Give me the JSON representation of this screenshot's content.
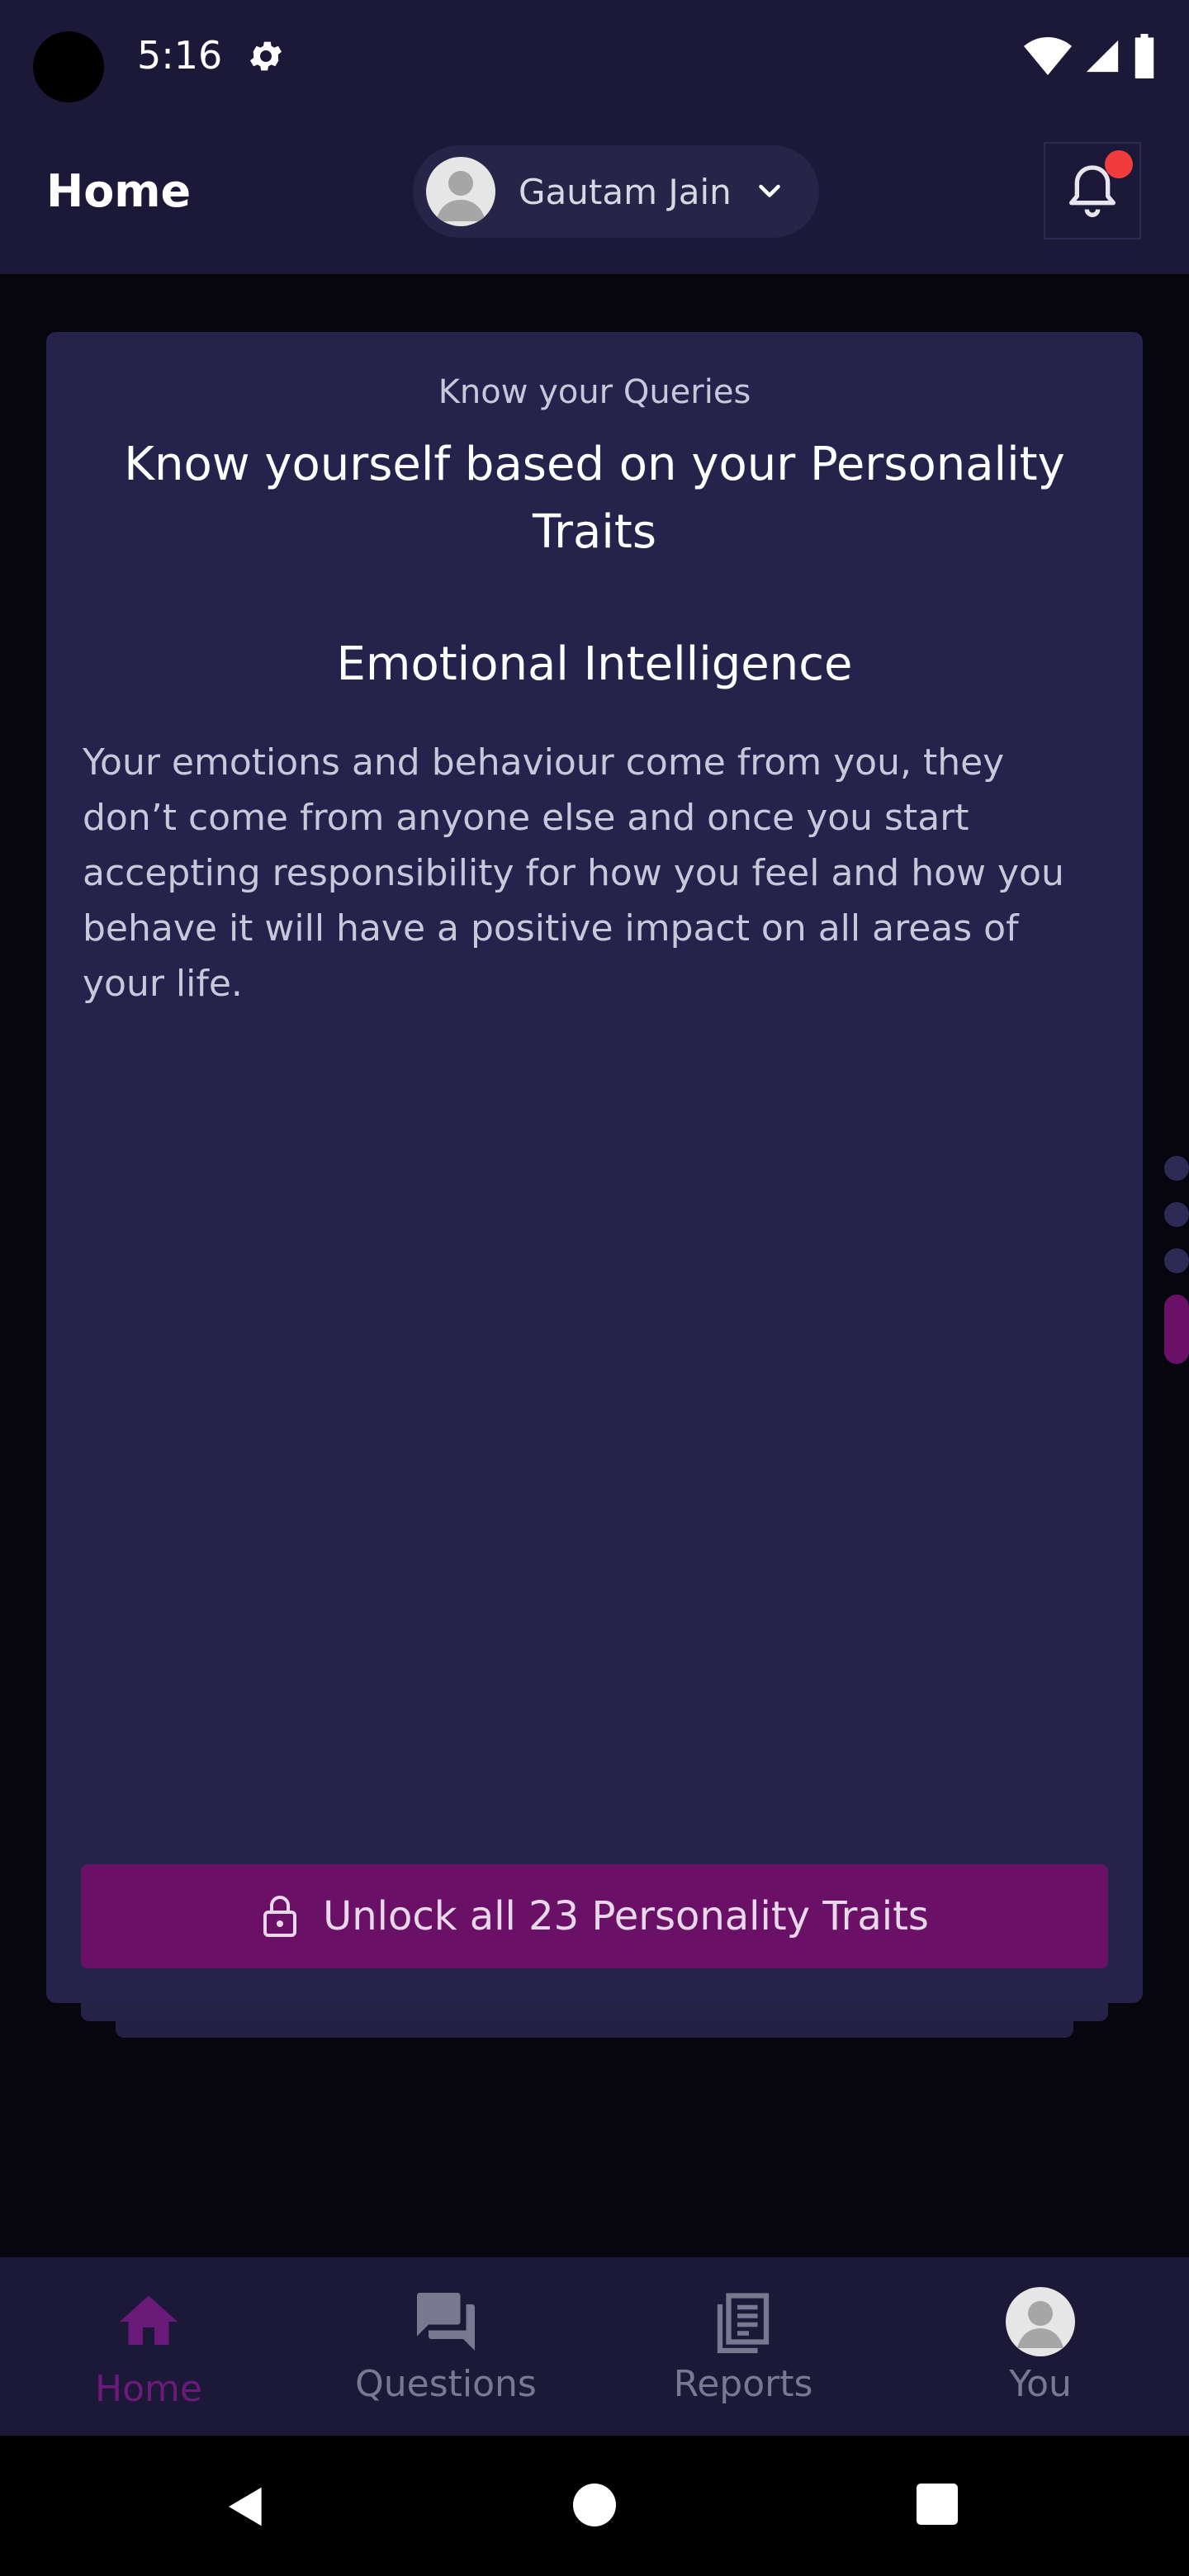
{
  "status_bar": {
    "time": "5:16"
  },
  "app_bar": {
    "title": "Home",
    "user_name": "Gautam Jain"
  },
  "card": {
    "kicker": "Know your Queries",
    "headline": "Know yourself based on your Personality Traits",
    "trait_title": "Emotional Intelligence",
    "description": "Your emotions and behaviour come from you, they don’t come from anyone else and once you start accepting responsibility for how you feel and how you behave it will have a positive impact on all areas of your life.",
    "unlock_label": "Unlock all 23 Personality Traits"
  },
  "pager": {
    "total": 4,
    "active_index": 3
  },
  "bottom_nav": {
    "items": [
      {
        "label": "Home",
        "icon": "home-icon",
        "active": true
      },
      {
        "label": "Questions",
        "icon": "forum-icon",
        "active": false
      },
      {
        "label": "Reports",
        "icon": "reports-icon",
        "active": false
      },
      {
        "label": "You",
        "icon": "avatar",
        "active": false
      }
    ]
  },
  "colors": {
    "appbar_bg": "#1b1838",
    "card_bg": "#25224b",
    "accent": "#6a1066",
    "notification_dot": "#f03c3c"
  }
}
